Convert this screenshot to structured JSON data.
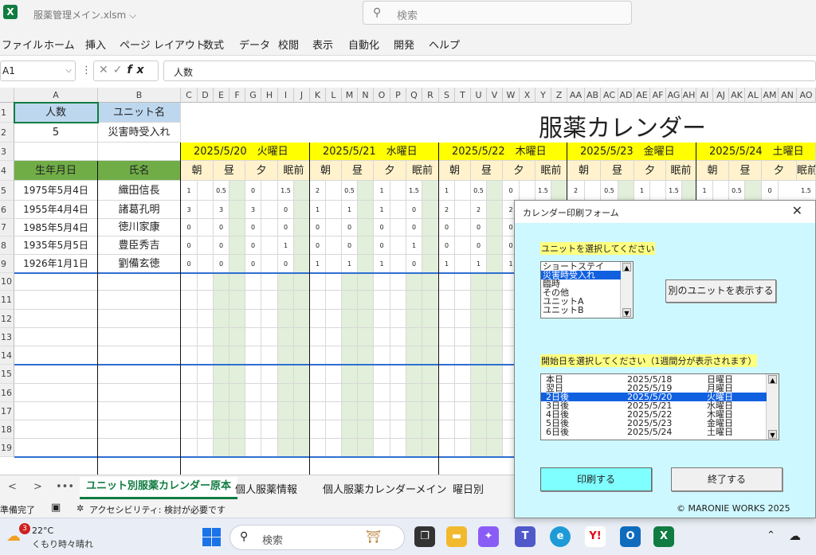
{
  "app": {
    "logo": "X",
    "filename": "服薬管理メイン.xlsm ⌵",
    "search_placeholder": "検索"
  },
  "menu": [
    "ファイル",
    "ホーム",
    "挿入",
    "ページ レイアウト",
    "数式",
    "データ",
    "校閲",
    "表示",
    "自動化",
    "開発",
    "ヘルプ"
  ],
  "formula_bar": {
    "cell_ref": "A1",
    "fx": "fx",
    "value": "人数"
  },
  "columns": [
    "A",
    "B",
    "C",
    "D",
    "E",
    "F",
    "G",
    "H",
    "I",
    "J",
    "K",
    "L",
    "M",
    "N",
    "O",
    "P",
    "Q",
    "R",
    "S",
    "T",
    "U",
    "V",
    "W",
    "X",
    "Y",
    "Z",
    "AA",
    "AB",
    "AC",
    "AD",
    "AE",
    "AF",
    "AG",
    "AH",
    "AI",
    "AJ",
    "AK",
    "AL",
    "AM",
    "AN",
    "AO"
  ],
  "rows": [
    "1",
    "2",
    "3",
    "4",
    "5",
    "6",
    "7",
    "8",
    "9",
    "10",
    "11",
    "12",
    "13",
    "14",
    "15",
    "16",
    "17",
    "18",
    "19"
  ],
  "sheet": {
    "a1": "人数",
    "b1": "ユニット名",
    "a2": "5",
    "b2": "災害時受入れ",
    "a4": "生年月日",
    "b4": "氏名",
    "title": "服薬カレンダー",
    "days": [
      "2025/5/20　火曜日",
      "2025/5/21　水曜日",
      "2025/5/22　木曜日",
      "2025/5/23　金曜日",
      "2025/5/24　土曜日"
    ],
    "slots": [
      "朝",
      "昼",
      "夕",
      "眠前"
    ],
    "patients": [
      {
        "dob": "1975年5月4日",
        "name": "織田信長",
        "doses": [
          [
            "1",
            "0.5",
            "0",
            "1.5"
          ],
          [
            "2",
            "0.5",
            "1",
            "1.5"
          ],
          [
            "1",
            "0.5",
            "0",
            "1.5"
          ],
          [
            "2",
            "0.5",
            "1",
            "1.5"
          ],
          [
            "1",
            "0.5",
            "0",
            "1.5"
          ]
        ]
      },
      {
        "dob": "1955年4月4日",
        "name": "諸葛孔明",
        "doses": [
          [
            "3",
            "3",
            "3",
            "0"
          ],
          [
            "1",
            "1",
            "1",
            "0"
          ],
          [
            "2",
            "2",
            "2",
            ""
          ],
          [
            "",
            "",
            "",
            ""
          ],
          [
            "",
            "",
            "",
            ""
          ]
        ]
      },
      {
        "dob": "1985年5月4日",
        "name": "徳川家康",
        "doses": [
          [
            "0",
            "0",
            "0",
            "0"
          ],
          [
            "0",
            "0",
            "0",
            "0"
          ],
          [
            "0",
            "0",
            "0",
            ""
          ],
          [
            "",
            "",
            "",
            ""
          ],
          [
            "",
            "",
            "",
            ""
          ]
        ]
      },
      {
        "dob": "1935年5月5日",
        "name": "豊臣秀吉",
        "doses": [
          [
            "0",
            "0",
            "0",
            "1"
          ],
          [
            "0",
            "0",
            "0",
            "1"
          ],
          [
            "0",
            "0",
            "0",
            ""
          ],
          [
            "",
            "",
            "",
            ""
          ],
          [
            "",
            "",
            "",
            ""
          ]
        ]
      },
      {
        "dob": "1926年1月1日",
        "name": "劉備玄徳",
        "doses": [
          [
            "0",
            "0",
            "0",
            "0"
          ],
          [
            "1",
            "1",
            "1",
            "0"
          ],
          [
            "1",
            "1",
            "1",
            ""
          ],
          [
            "",
            "",
            "",
            ""
          ],
          [
            "",
            "",
            "",
            ""
          ]
        ]
      }
    ]
  },
  "sheet_tabs": {
    "nav_prev": "<",
    "nav_next": ">",
    "more": "•••",
    "tabs": [
      "ユニット別服薬カレンダー原本",
      "個人服薬情報",
      "個人服薬カレンダーメイン",
      "曜日別"
    ]
  },
  "status": {
    "ready": "準備完了",
    "accessibility": "アクセシビリティ: 検討が必要です"
  },
  "taskbar": {
    "weather_badge": "3",
    "temp": "22°C",
    "weather": "くもり時々晴れ",
    "search": "検索"
  },
  "dialog": {
    "title": "カレンダー印刷フォーム",
    "close": "✕",
    "unit_label": "ユニットを選択してください",
    "units": [
      "ショートステイ",
      "災害時受入れ",
      "臨時",
      "その他",
      "ユニットA",
      "ユニットB"
    ],
    "unit_selected": 1,
    "show_other_unit": "別のユニットを表示する",
    "date_label": "開始日を選択してください（1週間分が表示されます）",
    "dates": [
      {
        "rel": "本日",
        "date": "2025/5/18",
        "dow": "日曜日"
      },
      {
        "rel": "翌日",
        "date": "2025/5/19",
        "dow": "月曜日"
      },
      {
        "rel": "2日後",
        "date": "2025/5/20",
        "dow": "火曜日"
      },
      {
        "rel": "3日後",
        "date": "2025/5/21",
        "dow": "水曜日"
      },
      {
        "rel": "4日後",
        "date": "2025/5/22",
        "dow": "木曜日"
      },
      {
        "rel": "5日後",
        "date": "2025/5/23",
        "dow": "金曜日"
      },
      {
        "rel": "6日後",
        "date": "2025/5/24",
        "dow": "土曜日"
      }
    ],
    "date_selected": 2,
    "print": "印刷する",
    "exit": "終了する",
    "copyright": "© MARONIE WORKS 2025"
  }
}
